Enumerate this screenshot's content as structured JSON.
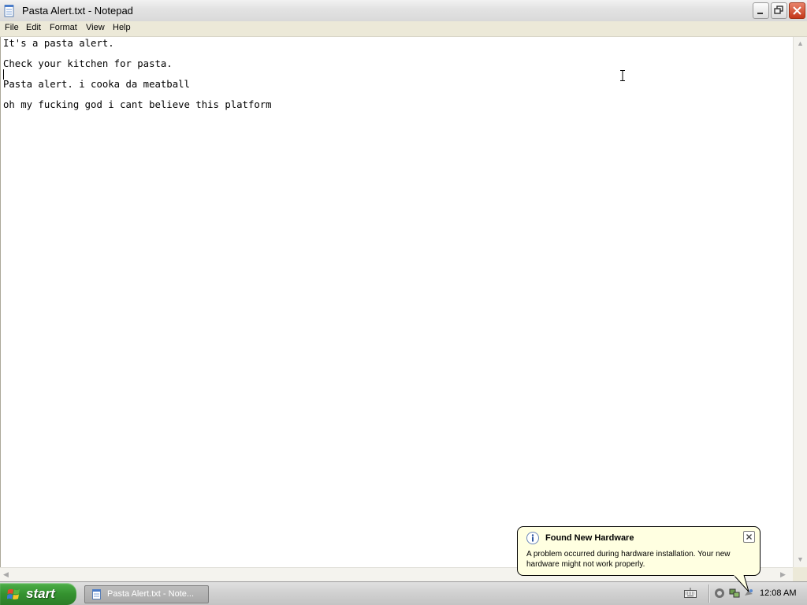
{
  "window": {
    "title": "Pasta Alert.txt - Notepad",
    "icon": "notepad-icon"
  },
  "menu": {
    "items": [
      "File",
      "Edit",
      "Format",
      "View",
      "Help"
    ]
  },
  "editor": {
    "lines": [
      "It's a pasta alert.",
      "Check your kitchen for pasta.",
      "Pasta alert. i cooka da meatball",
      "oh my fucking god i cant believe this platform"
    ]
  },
  "taskbar": {
    "start_label": "start",
    "task_label": "Pasta Alert.txt - Note...",
    "clock": "12:08 AM"
  },
  "balloon": {
    "title": "Found New Hardware",
    "text": "A problem occurred during hardware installation. Your new hardware might not work properly.",
    "icon": "info-icon"
  },
  "colors": {
    "start_green": "#3c9e36",
    "balloon_bg": "#ffffe1",
    "close_red": "#c4381a"
  }
}
